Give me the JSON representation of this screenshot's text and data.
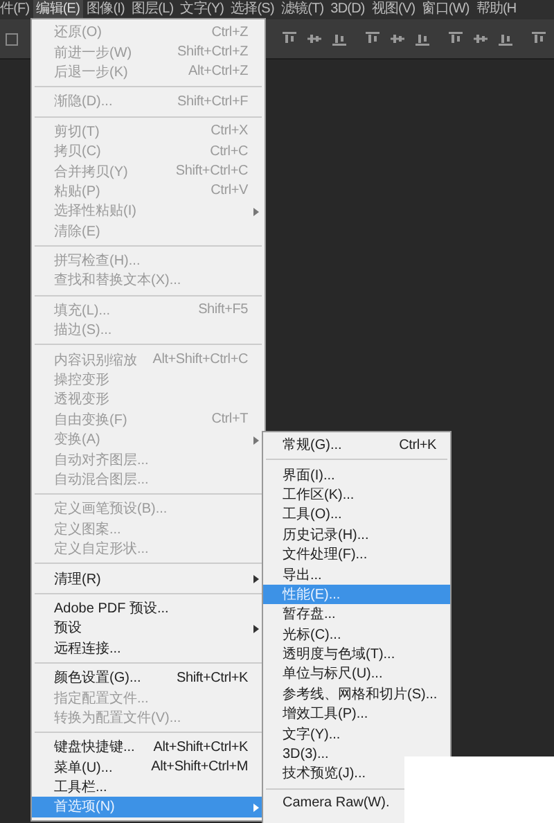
{
  "menubar": [
    {
      "label": "件(F)",
      "selected": false
    },
    {
      "label": "编辑(E)",
      "selected": true
    },
    {
      "label": "图像(I)",
      "selected": false
    },
    {
      "label": "图层(L)",
      "selected": false
    },
    {
      "label": "文字(Y)",
      "selected": false
    },
    {
      "label": "选择(S)",
      "selected": false
    },
    {
      "label": "滤镜(T)",
      "selected": false
    },
    {
      "label": "3D(D)",
      "selected": false
    },
    {
      "label": "视图(V)",
      "selected": false
    },
    {
      "label": "窗口(W)",
      "selected": false
    },
    {
      "label": "帮助(H",
      "selected": false
    }
  ],
  "toolbar": {
    "checkbox": {
      "checked": false
    }
  },
  "edit_menu": {
    "items": [
      {
        "kind": "item",
        "label": "还原(O)",
        "shortcut": "Ctrl+Z",
        "disabled": true,
        "submenu": false,
        "selected": false
      },
      {
        "kind": "item",
        "label": "前进一步(W)",
        "shortcut": "Shift+Ctrl+Z",
        "disabled": true,
        "submenu": false,
        "selected": false
      },
      {
        "kind": "item",
        "label": "后退一步(K)",
        "shortcut": "Alt+Ctrl+Z",
        "disabled": true,
        "submenu": false,
        "selected": false
      },
      {
        "kind": "separator"
      },
      {
        "kind": "item",
        "label": "渐隐(D)...",
        "shortcut": "Shift+Ctrl+F",
        "disabled": true,
        "submenu": false,
        "selected": false
      },
      {
        "kind": "separator"
      },
      {
        "kind": "item",
        "label": "剪切(T)",
        "shortcut": "Ctrl+X",
        "disabled": true,
        "submenu": false,
        "selected": false
      },
      {
        "kind": "item",
        "label": "拷贝(C)",
        "shortcut": "Ctrl+C",
        "disabled": true,
        "submenu": false,
        "selected": false
      },
      {
        "kind": "item",
        "label": "合并拷贝(Y)",
        "shortcut": "Shift+Ctrl+C",
        "disabled": true,
        "submenu": false,
        "selected": false
      },
      {
        "kind": "item",
        "label": "粘贴(P)",
        "shortcut": "Ctrl+V",
        "disabled": true,
        "submenu": false,
        "selected": false
      },
      {
        "kind": "item",
        "label": "选择性粘贴(I)",
        "disabled": true,
        "submenu": true,
        "selected": false
      },
      {
        "kind": "item",
        "label": "清除(E)",
        "disabled": true,
        "submenu": false,
        "selected": false
      },
      {
        "kind": "separator"
      },
      {
        "kind": "item",
        "label": "拼写检查(H)...",
        "disabled": true,
        "submenu": false,
        "selected": false
      },
      {
        "kind": "item",
        "label": "查找和替换文本(X)...",
        "disabled": true,
        "submenu": false,
        "selected": false
      },
      {
        "kind": "separator"
      },
      {
        "kind": "item",
        "label": "填充(L)...",
        "shortcut": "Shift+F5",
        "disabled": true,
        "submenu": false,
        "selected": false
      },
      {
        "kind": "item",
        "label": "描边(S)...",
        "disabled": true,
        "submenu": false,
        "selected": false
      },
      {
        "kind": "separator"
      },
      {
        "kind": "item",
        "label": "内容识别缩放",
        "shortcut": "Alt+Shift+Ctrl+C",
        "disabled": true,
        "submenu": false,
        "selected": false
      },
      {
        "kind": "item",
        "label": "操控变形",
        "disabled": true,
        "submenu": false,
        "selected": false
      },
      {
        "kind": "item",
        "label": "透视变形",
        "disabled": true,
        "submenu": false,
        "selected": false
      },
      {
        "kind": "item",
        "label": "自由变换(F)",
        "shortcut": "Ctrl+T",
        "disabled": true,
        "submenu": false,
        "selected": false
      },
      {
        "kind": "item",
        "label": "变换(A)",
        "disabled": true,
        "submenu": true,
        "selected": false
      },
      {
        "kind": "item",
        "label": "自动对齐图层...",
        "disabled": true,
        "submenu": false,
        "selected": false
      },
      {
        "kind": "item",
        "label": "自动混合图层...",
        "disabled": true,
        "submenu": false,
        "selected": false
      },
      {
        "kind": "separator"
      },
      {
        "kind": "item",
        "label": "定义画笔预设(B)...",
        "disabled": true,
        "submenu": false,
        "selected": false
      },
      {
        "kind": "item",
        "label": "定义图案...",
        "disabled": true,
        "submenu": false,
        "selected": false
      },
      {
        "kind": "item",
        "label": "定义自定形状...",
        "disabled": true,
        "submenu": false,
        "selected": false
      },
      {
        "kind": "separator"
      },
      {
        "kind": "item",
        "label": "清理(R)",
        "disabled": false,
        "submenu": true,
        "selected": false
      },
      {
        "kind": "separator"
      },
      {
        "kind": "item",
        "label": "Adobe PDF 预设...",
        "disabled": false,
        "submenu": false,
        "selected": false
      },
      {
        "kind": "item",
        "label": "预设",
        "disabled": false,
        "submenu": true,
        "selected": false
      },
      {
        "kind": "item",
        "label": "远程连接...",
        "disabled": false,
        "submenu": false,
        "selected": false
      },
      {
        "kind": "separator"
      },
      {
        "kind": "item",
        "label": "颜色设置(G)...",
        "shortcut": "Shift+Ctrl+K",
        "disabled": false,
        "submenu": false,
        "selected": false
      },
      {
        "kind": "item",
        "label": "指定配置文件...",
        "disabled": true,
        "submenu": false,
        "selected": false
      },
      {
        "kind": "item",
        "label": "转换为配置文件(V)...",
        "disabled": true,
        "submenu": false,
        "selected": false
      },
      {
        "kind": "separator"
      },
      {
        "kind": "item",
        "label": "键盘快捷键...",
        "shortcut": "Alt+Shift+Ctrl+K",
        "disabled": false,
        "submenu": false,
        "selected": false
      },
      {
        "kind": "item",
        "label": "菜单(U)...",
        "shortcut": "Alt+Shift+Ctrl+M",
        "disabled": false,
        "submenu": false,
        "selected": false
      },
      {
        "kind": "item",
        "label": "工具栏...",
        "disabled": false,
        "submenu": false,
        "selected": false
      },
      {
        "kind": "item",
        "label": "首选项(N)",
        "disabled": false,
        "submenu": true,
        "selected": true
      }
    ]
  },
  "preferences_submenu": {
    "items": [
      {
        "kind": "item",
        "label": "常规(G)...",
        "shortcut": "Ctrl+K",
        "selected": false
      },
      {
        "kind": "separator"
      },
      {
        "kind": "item",
        "label": "界面(I)...",
        "selected": false
      },
      {
        "kind": "item",
        "label": "工作区(K)...",
        "selected": false
      },
      {
        "kind": "item",
        "label": "工具(O)...",
        "selected": false
      },
      {
        "kind": "item",
        "label": "历史记录(H)...",
        "selected": false
      },
      {
        "kind": "item",
        "label": "文件处理(F)...",
        "selected": false
      },
      {
        "kind": "item",
        "label": "导出...",
        "selected": false
      },
      {
        "kind": "item",
        "label": "性能(E)...",
        "selected": true
      },
      {
        "kind": "item",
        "label": "暂存盘...",
        "selected": false
      },
      {
        "kind": "item",
        "label": "光标(C)...",
        "selected": false
      },
      {
        "kind": "item",
        "label": "透明度与色域(T)...",
        "selected": false
      },
      {
        "kind": "item",
        "label": "单位与标尺(U)...",
        "selected": false
      },
      {
        "kind": "item",
        "label": "参考线、网格和切片(S)...",
        "selected": false
      },
      {
        "kind": "item",
        "label": "增效工具(P)...",
        "selected": false
      },
      {
        "kind": "item",
        "label": "文字(Y)...",
        "selected": false
      },
      {
        "kind": "item",
        "label": "3D(3)...",
        "selected": false
      },
      {
        "kind": "item",
        "label": "技术预览(J)...",
        "selected": false
      },
      {
        "kind": "separator"
      },
      {
        "kind": "item",
        "label": "Camera Raw(W).",
        "selected": false
      }
    ]
  }
}
